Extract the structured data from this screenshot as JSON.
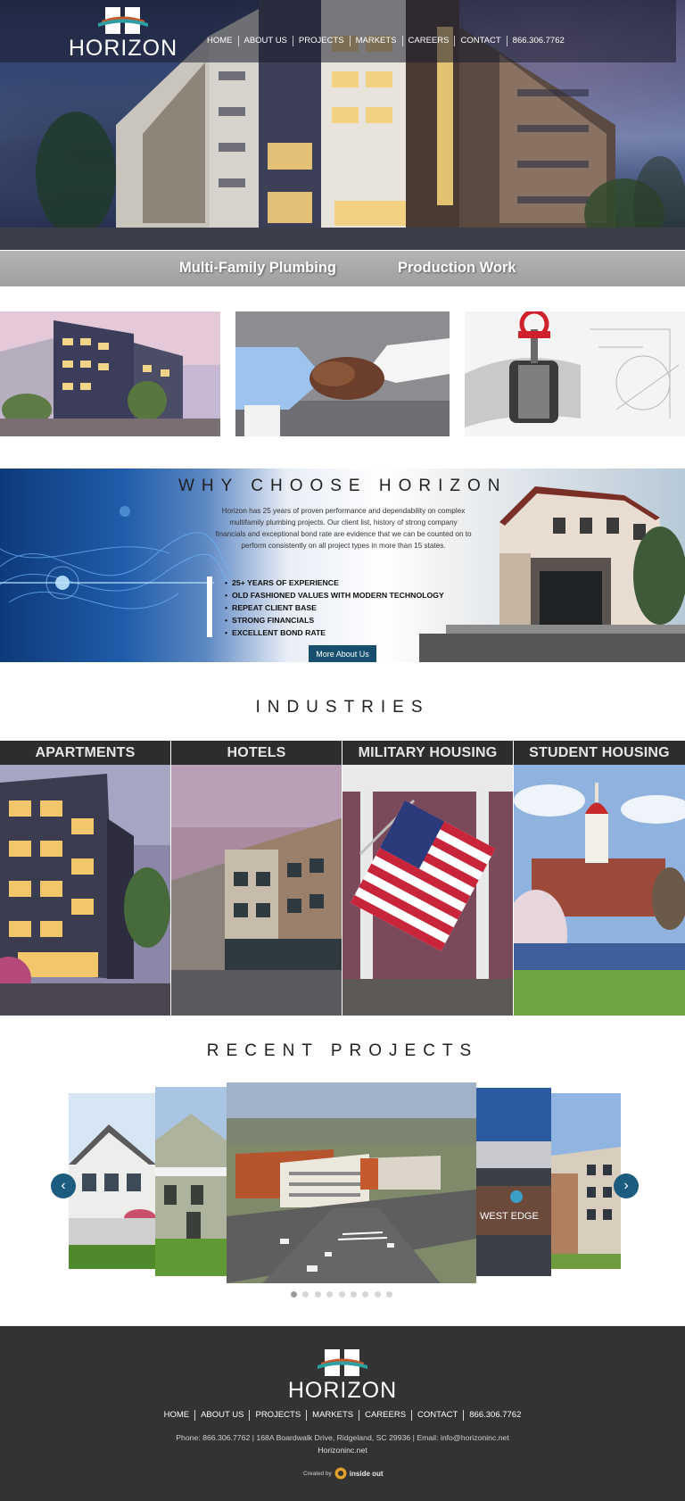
{
  "brand": {
    "name": "HORIZON"
  },
  "nav": {
    "items": [
      "HOME",
      "ABOUT US",
      "PROJECTS",
      "MARKETS",
      "CAREERS",
      "CONTACT",
      "866.306.7762"
    ]
  },
  "hero": {
    "band_left": "Multi-Family Plumbing",
    "band_right": "Production Work"
  },
  "why": {
    "title": "WHY CHOOSE HORIZON",
    "text": "Horizon has 25 years of proven performance and dependability on complex multifamily plumbing projects. Our client list, history of strong company financials and exceptional bond rate are evidence that we can be counted on to perform consistently on all project types in more than 15 states.",
    "bullets": [
      "25+ YEARS OF EXPERIENCE",
      "OLD FASHIONED VALUES WITH MODERN TECHNOLOGY",
      "REPEAT CLIENT BASE",
      "STRONG FINANCIALS",
      "EXCELLENT BOND RATE"
    ],
    "button": "More About Us"
  },
  "industries": {
    "title": "INDUSTRIES",
    "items": [
      "APARTMENTS",
      "HOTELS",
      "MILITARY HOUSING",
      "STUDENT HOUSING"
    ]
  },
  "projects": {
    "title": "RECENT PROJECTS",
    "prev_icon": "‹",
    "next_icon": "›",
    "slide_sign": "WEST EDGE",
    "dot_count": 9,
    "active_dot": 1
  },
  "footer": {
    "nav": [
      "HOME",
      "ABOUT US",
      "PROJECTS",
      "MARKETS",
      "CAREERS",
      "CONTACT",
      "866.306.7762"
    ],
    "contact": "Phone: 866.306.7762 | 168A Boardwalk Drive, Ridgeland, SC 29936 | Email: info@horizoninc.net",
    "site": "Horizoninc.net",
    "created_by": "Created by",
    "agency": "inside out"
  },
  "colors": {
    "accent": "#174f6e",
    "arrow": "#1c5c7f",
    "footer_bg": "#333333",
    "band": "#a8a8a8",
    "industry_header": "#2d2d2d"
  }
}
